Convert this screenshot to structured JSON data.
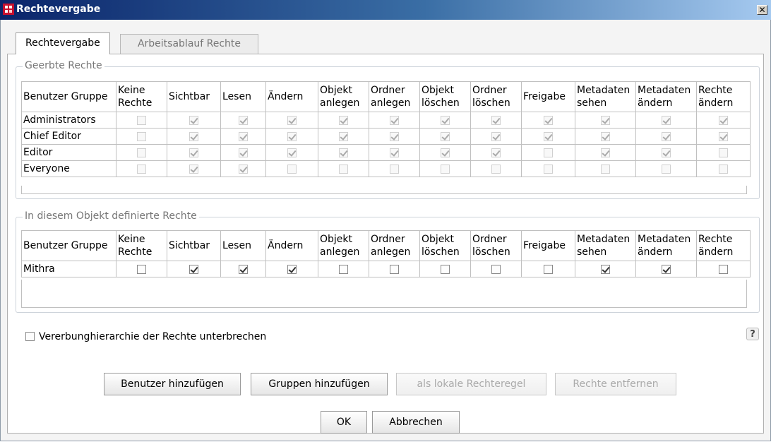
{
  "window": {
    "title": "Rechtevergabe",
    "close_glyph": "✕"
  },
  "tabs": [
    {
      "label": "Rechtevergabe"
    },
    {
      "label": "Arbeitsablauf Rechte"
    }
  ],
  "columns": [
    "Benutzer Gruppe",
    "Keine Rechte",
    "Sichtbar",
    "Lesen",
    "Ändern",
    "Objekt anlegen",
    "Ordner anlegen",
    "Objekt löschen",
    "Ordner löschen",
    "Freigabe",
    "Metadaten sehen",
    "Metadaten ändern",
    "Rechte ändern"
  ],
  "inherited": {
    "legend": "Geerbte Rechte",
    "rows": [
      {
        "name": "Administrators",
        "values": [
          false,
          true,
          true,
          true,
          true,
          true,
          true,
          true,
          true,
          true,
          true,
          true
        ]
      },
      {
        "name": "Chief Editor",
        "values": [
          false,
          true,
          true,
          true,
          true,
          true,
          true,
          true,
          true,
          true,
          true,
          true
        ]
      },
      {
        "name": "Editor",
        "values": [
          false,
          true,
          true,
          true,
          true,
          true,
          true,
          true,
          false,
          true,
          true,
          false
        ]
      },
      {
        "name": "Everyone",
        "values": [
          false,
          true,
          true,
          false,
          false,
          false,
          false,
          false,
          false,
          false,
          false,
          false
        ]
      }
    ]
  },
  "defined": {
    "legend": "In diesem Objekt definierte Rechte",
    "rows": [
      {
        "name": "Mithra",
        "values": [
          false,
          true,
          true,
          true,
          false,
          false,
          false,
          false,
          false,
          true,
          true,
          false
        ]
      }
    ]
  },
  "inherit_break_label": "Vererbunghierarchie der Rechte unterbrechen",
  "help_glyph": "?",
  "buttons": {
    "add_user": "Benutzer hinzufügen",
    "add_group": "Gruppen hinzufügen",
    "local_rule": "als lokale Rechteregel",
    "remove_rights": "Rechte entfernen",
    "ok": "OK",
    "cancel": "Abbrechen"
  },
  "colors": {
    "titlebar_start": "#0a246a",
    "titlebar_end": "#a6caf0",
    "accent": "#c8102e"
  }
}
